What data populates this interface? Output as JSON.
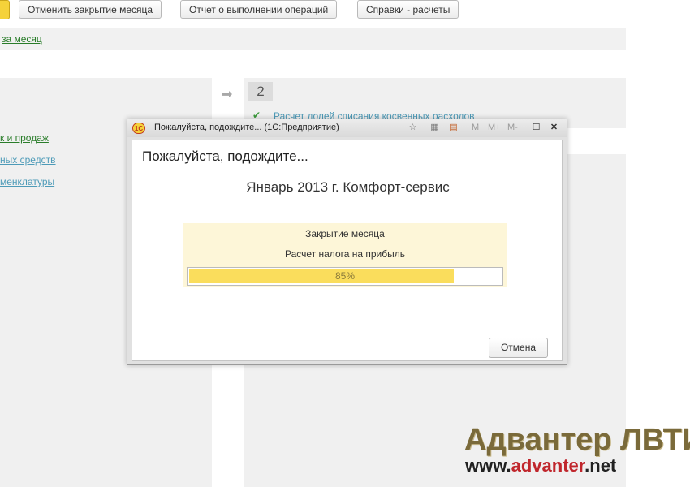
{
  "toolbar": {
    "buttons": [
      "Отменить закрытие месяца",
      "Отчет о выполнении операций",
      "Справки - расчеты"
    ]
  },
  "background": {
    "month_link": "за месяц",
    "left_links": [
      "к и продаж",
      "ных средств",
      "менклатуры"
    ],
    "step_number": "2",
    "task_text": "Расчет долей списания косвенных расходов"
  },
  "dialog": {
    "title": "Пожалуйста, подождите...  (1С:Предприятие)",
    "heading": "Пожалуйста, подождите...",
    "subtitle": "Январь 2013 г. Комфорт-сервис",
    "operation": "Закрытие месяца",
    "step": "Расчет налога на прибыль",
    "progress": {
      "value": 85,
      "label": "85%"
    },
    "cancel_label": "Отмена",
    "titlebar_buttons": {
      "m": "M",
      "m_plus": "M+",
      "m_minus": "M-"
    }
  },
  "watermark": {
    "line1": "Адвантер ЛВТИ",
    "line2_prefix": "www.",
    "line2_brand": "advanter",
    "line2_suffix": ".net"
  },
  "colors": {
    "progress_fill": "#fadd5c",
    "status_bg": "#fdf6d8",
    "link_green": "#2a7d2a"
  }
}
